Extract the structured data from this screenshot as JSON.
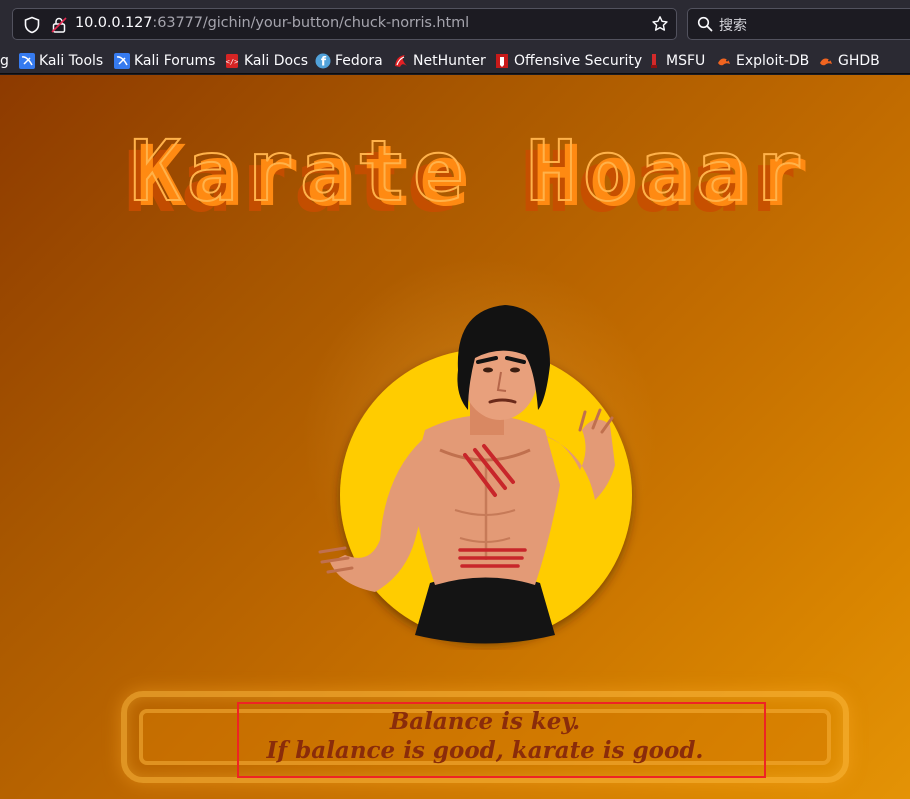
{
  "browser": {
    "url_host": "10.0.0.127",
    "url_path": ":63777/gichin/your-button/chuck-norris.html",
    "search_placeholder": "搜索",
    "bookmarks": [
      {
        "label": "g",
        "icon": "generic-icon"
      },
      {
        "label": "Kali Tools",
        "icon": "kali-icon"
      },
      {
        "label": "Kali Forums",
        "icon": "kali-icon"
      },
      {
        "label": "Kali Docs",
        "icon": "kali-docs-icon"
      },
      {
        "label": "Fedora",
        "icon": "fedora-icon"
      },
      {
        "label": "NetHunter",
        "icon": "nethunter-icon"
      },
      {
        "label": "Offensive Security",
        "icon": "offsec-icon"
      },
      {
        "label": "MSFU",
        "icon": "msfu-icon"
      },
      {
        "label": "Exploit-DB",
        "icon": "exploitdb-icon"
      },
      {
        "label": "GHDB",
        "icon": "ghdb-icon"
      }
    ]
  },
  "page": {
    "title": "Karate Hoaar",
    "quote_line1": "Balance is key.",
    "quote_line2": "If balance is good, karate is good."
  },
  "colors": {
    "page_gradient_start": "#8d3a00",
    "page_gradient_end": "#e49306",
    "sun_yellow": "#ffcc00",
    "quote_text": "#8a2c0a",
    "highlight_box": "#ee2424"
  }
}
